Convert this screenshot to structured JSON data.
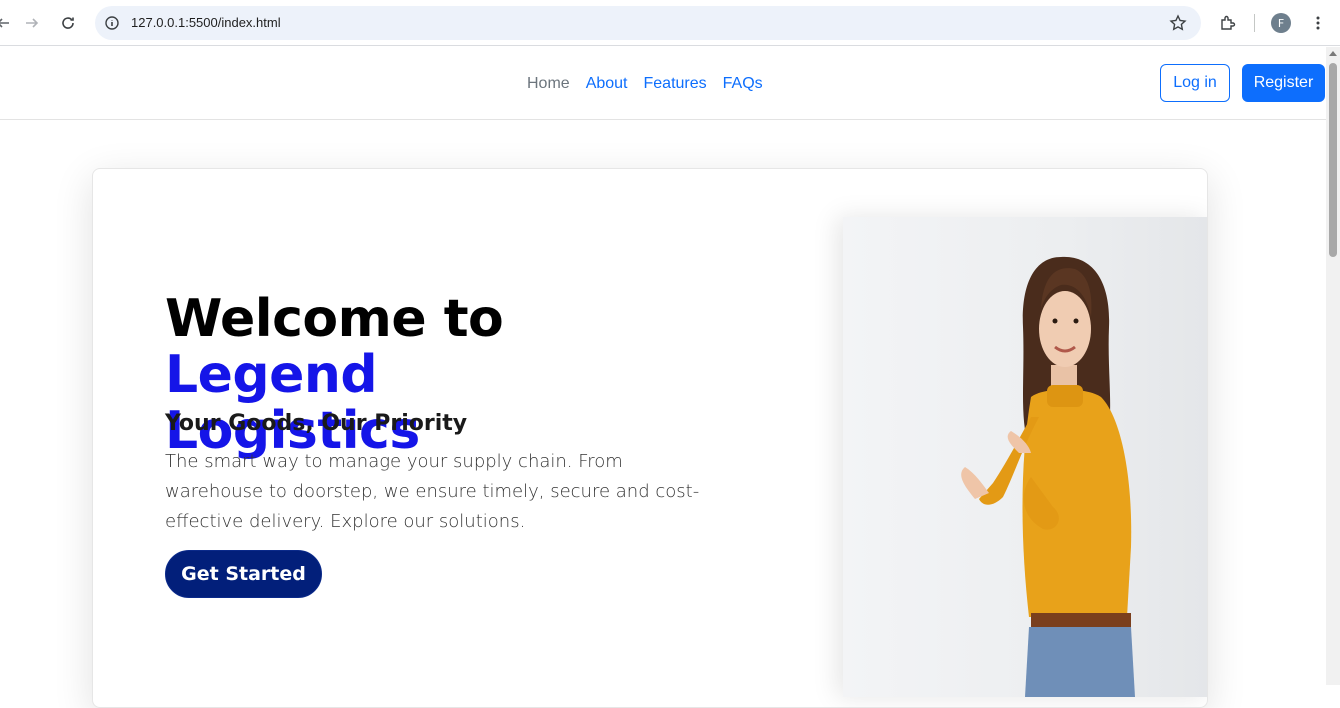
{
  "browser": {
    "url": "127.0.0.1:5500/index.html",
    "profile_initial": "F"
  },
  "nav": {
    "links": [
      {
        "label": "Home",
        "active": true
      },
      {
        "label": "About",
        "active": false
      },
      {
        "label": "Features",
        "active": false
      },
      {
        "label": "FAQs",
        "active": false
      }
    ],
    "login_label": "Log in",
    "register_label": "Register"
  },
  "hero": {
    "title_prefix": "Welcome to ",
    "title_accent_1": "Legend",
    "title_accent_2": "Logistics",
    "subtitle": "Your Goods, Our Priority",
    "text": "The smart way to manage your supply chain. From warehouse to doorstep, we ensure timely, secure and cost-effective delivery. Explore our solutions.",
    "cta_label": "Get Started"
  },
  "colors": {
    "primary": "#0d6efd",
    "accent_title": "#1515e8",
    "cta_bg": "#021f7a",
    "sweater": "#e8a21a"
  }
}
